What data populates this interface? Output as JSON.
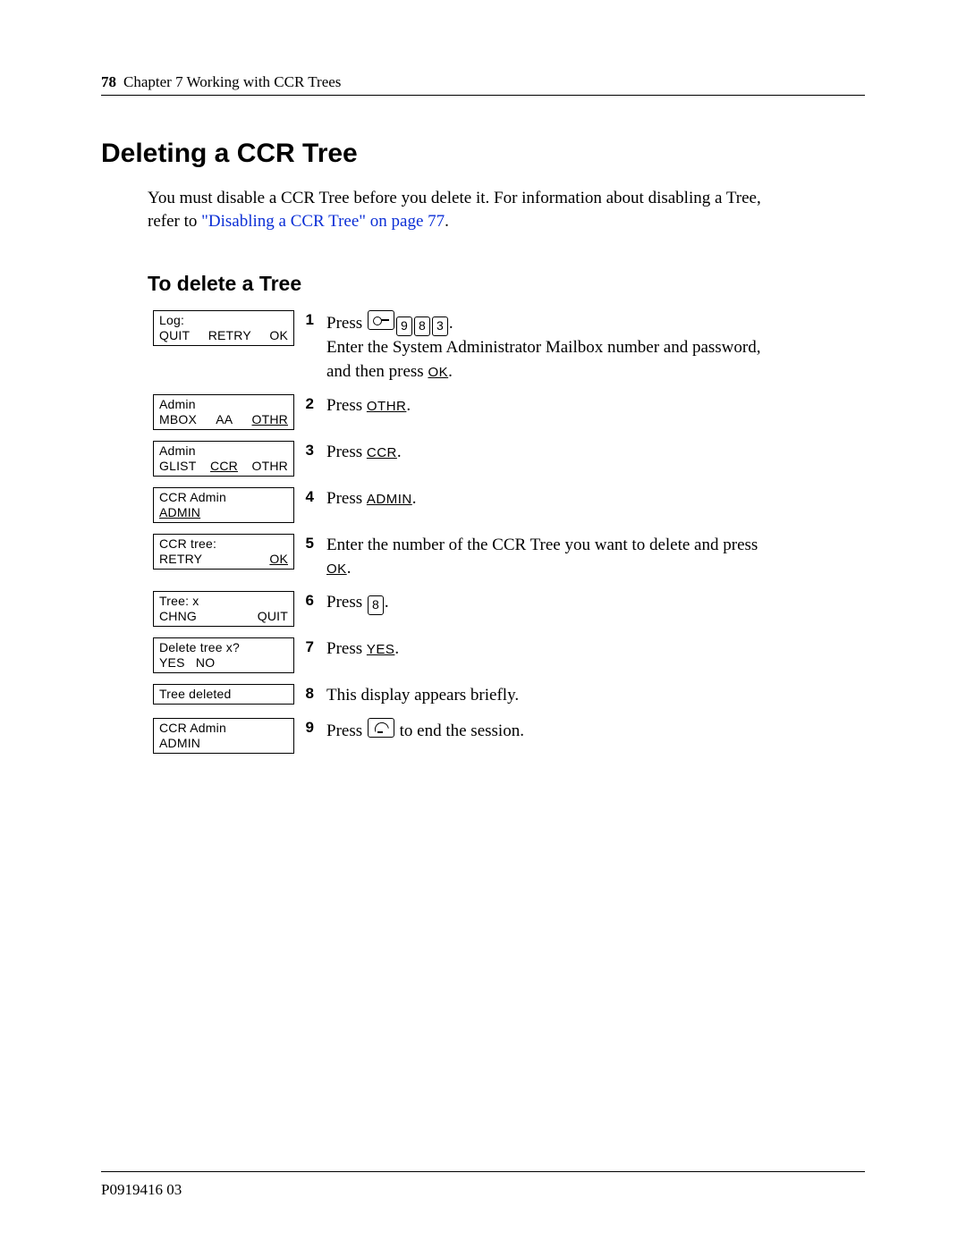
{
  "header": {
    "page_number": "78",
    "chapter": "Chapter 7  Working with CCR Trees"
  },
  "title": "Deleting a CCR Tree",
  "intro_a": "You must disable a CCR Tree before you delete it. For information about disabling a Tree, refer to ",
  "intro_xref": "\"Disabling a CCR Tree\" on page 77",
  "intro_b": ".",
  "section": "To delete a Tree",
  "steps": [
    {
      "n": "1",
      "lcd": {
        "line1": "Log:",
        "sk": [
          {
            "t": "QUIT"
          },
          {
            "t": "RETRY"
          },
          {
            "t": "OK"
          }
        ]
      },
      "pre": "Press ",
      "keys": [
        "feature",
        "9",
        "8",
        "3"
      ],
      "post": ".",
      "lines": [
        "Enter the System Administrator Mailbox number and password, and then press "
      ],
      "trail_key_label": "OK",
      "trail_post": "."
    },
    {
      "n": "2",
      "lcd": {
        "line1": "Admin",
        "sk": [
          {
            "t": "MBOX"
          },
          {
            "t": "AA"
          },
          {
            "t": "OTHR",
            "u": true
          }
        ]
      },
      "pre": "Press ",
      "label": "OTHR",
      "post": "."
    },
    {
      "n": "3",
      "lcd": {
        "line1": "Admin",
        "sk": [
          {
            "t": "GLIST"
          },
          {
            "t": "CCR",
            "u": true
          },
          {
            "t": "OTHR"
          }
        ]
      },
      "pre": "Press ",
      "label": "CCR",
      "post": "."
    },
    {
      "n": "4",
      "lcd": {
        "line1": "CCR Admin",
        "sk": [
          {
            "t": "ADMIN",
            "u": true
          },
          {
            "t": ""
          },
          {
            "t": ""
          }
        ]
      },
      "pre": "Press ",
      "label": "ADMIN",
      "post": "."
    },
    {
      "n": "5",
      "lcd": {
        "line1": "CCR tree:",
        "sk": [
          {
            "t": "RETRY"
          },
          {
            "t": ""
          },
          {
            "t": "OK",
            "u": true
          }
        ]
      },
      "text_a": "Enter the number of the CCR Tree you want to delete and press ",
      "label": "OK",
      "post": "."
    },
    {
      "n": "6",
      "lcd": {
        "line1": "Tree: x",
        "sk": [
          {
            "t": "CHNG"
          },
          {
            "t": ""
          },
          {
            "t": "QUIT"
          }
        ]
      },
      "pre": "Press ",
      "keys": [
        "8"
      ],
      "post": "."
    },
    {
      "n": "7",
      "lcd": {
        "line1": "Delete tree x?",
        "sk": [
          {
            "t": "YES"
          },
          {
            "t": "NO"
          },
          {
            "t": ""
          }
        ],
        "tight": true
      },
      "pre": "Press ",
      "label": "YES",
      "post": "."
    },
    {
      "n": "8",
      "lcd": {
        "line1": "Tree deleted",
        "single": true
      },
      "text_a": "This display appears briefly."
    },
    {
      "n": "9",
      "lcd": {
        "line1": "CCR Admin",
        "sk": [
          {
            "t": "ADMIN"
          },
          {
            "t": ""
          },
          {
            "t": ""
          }
        ]
      },
      "pre": "Press ",
      "keys": [
        "rls"
      ],
      "post_text": " to end the session."
    }
  ],
  "footer": "P0919416 03"
}
